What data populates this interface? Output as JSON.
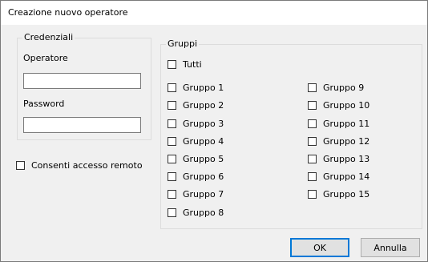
{
  "window": {
    "title": "Creazione nuovo operatore"
  },
  "credenziali": {
    "legend": "Credenziali",
    "operatore_label": "Operatore",
    "operatore_value": "",
    "password_label": "Password",
    "password_value": ""
  },
  "remote_access": {
    "label": "Consenti accesso remoto",
    "checked": false
  },
  "gruppi": {
    "legend": "Gruppi",
    "tutti": "Tutti",
    "items": [
      "Gruppo 1",
      "Gruppo 2",
      "Gruppo 3",
      "Gruppo 4",
      "Gruppo 5",
      "Gruppo 6",
      "Gruppo 7",
      "Gruppo 8",
      "Gruppo 9",
      "Gruppo 10",
      "Gruppo 11",
      "Gruppo 12",
      "Gruppo 13",
      "Gruppo 14",
      "Gruppo 15"
    ]
  },
  "buttons": {
    "ok": "OK",
    "cancel": "Annulla"
  }
}
